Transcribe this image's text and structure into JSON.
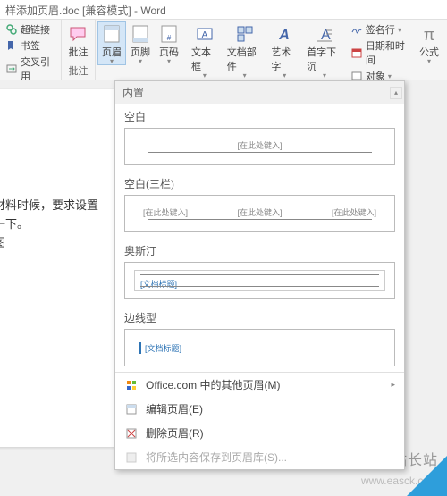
{
  "title_bar": "样添加页眉.doc [兼容模式] - Word",
  "ribbon": {
    "links_group": {
      "hyperlink": "超链接",
      "bookmark": "书签",
      "crossref": "交叉引用"
    },
    "comments_group": {
      "comment": "批注",
      "label": "批注"
    },
    "header_btn": "页眉",
    "footer_btn": "页脚",
    "pagenum_btn": "页码",
    "textbox_btn": "文本框",
    "parts_btn": "文档部件",
    "wordart_btn": "艺术字",
    "dropcap_btn": "首字下沉",
    "sigline": "签名行",
    "datetime": "日期和时间",
    "object": "对象",
    "equation_btn": "公式"
  },
  "document": {
    "line1": "些材料时候，要求设置",
    "line2": "绍一下。",
    "line3": "如图"
  },
  "dropdown": {
    "section_builtin": "内置",
    "blank": {
      "label": "空白",
      "placeholder": "[在此处键入]"
    },
    "blank3": {
      "label": "空白(三栏)",
      "ph1": "[在此处键入]",
      "ph2": "[在此处键入]",
      "ph3": "[在此处键入]"
    },
    "austin": {
      "label": "奥斯汀",
      "placeholder": "[文档标题]"
    },
    "sideline": {
      "label": "边线型",
      "placeholder": "[文档标题]"
    },
    "more_office": "Office.com 中的其他页眉(M)",
    "edit": "编辑页眉(E)",
    "remove": "删除页眉(R)",
    "save_sel": "将所选内容保存到页眉库(S)..."
  },
  "watermark": {
    "main": "易采站长站",
    "sub": "www.easck.com"
  }
}
